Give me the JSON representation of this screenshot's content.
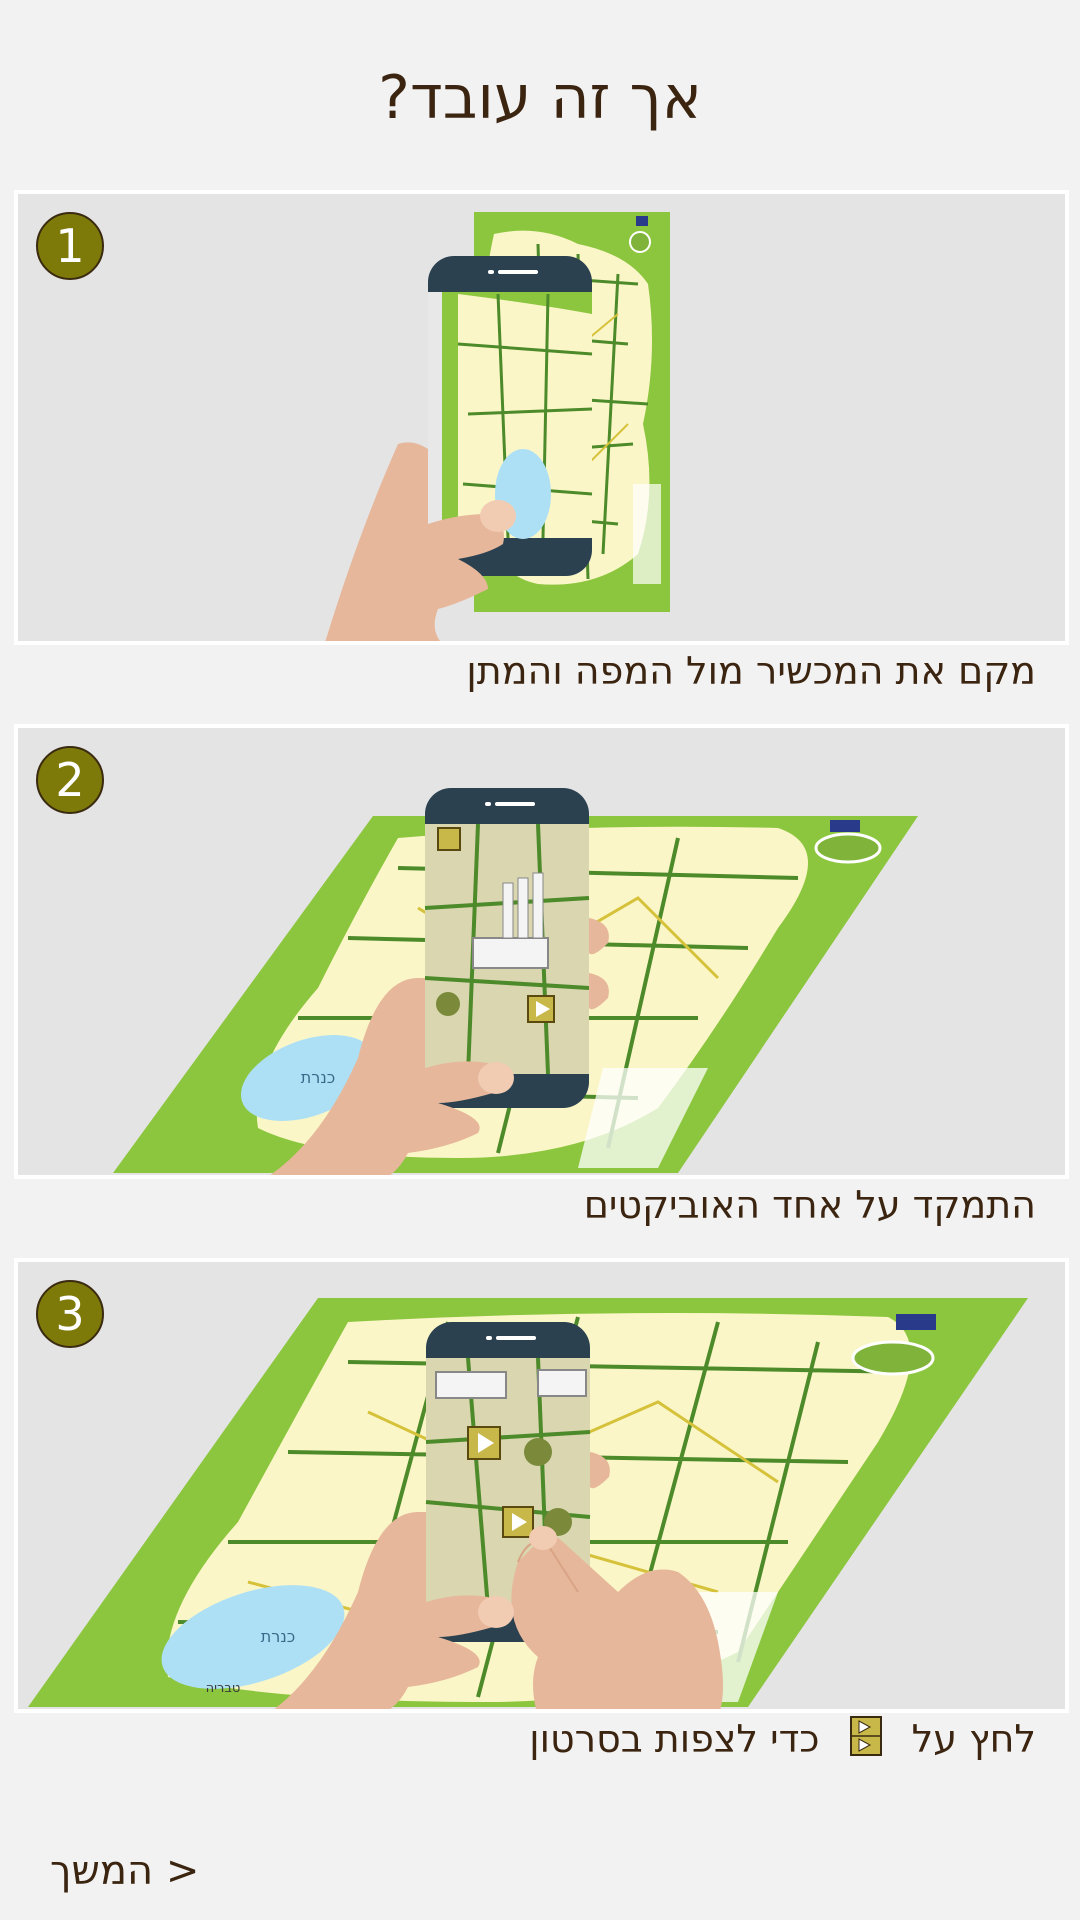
{
  "page": {
    "title": "אך זה עובד?"
  },
  "steps": [
    {
      "number": "1",
      "caption": "מקם את המכשיר מול המפה והמתן"
    },
    {
      "number": "2",
      "caption": "התמקד על אחד האוביקטים"
    },
    {
      "number": "3",
      "caption_before": "לחץ על",
      "caption_after": "כדי לצפות בסרטון",
      "icon": "play-box-icon"
    }
  ],
  "map_labels": {
    "lake": "כנרת",
    "city": "טבריה"
  },
  "nav": {
    "continue_label": "המשך >"
  },
  "colors": {
    "background": "#f2f2f2",
    "panel": "#e4e4e4",
    "badge": "#7d7a0a",
    "text": "#3b2410",
    "map_green": "#8cc63f",
    "map_cream": "#fbf6c8",
    "lake": "#aee0f5",
    "phone": "#2b4150",
    "skin": "#e6b79a"
  }
}
